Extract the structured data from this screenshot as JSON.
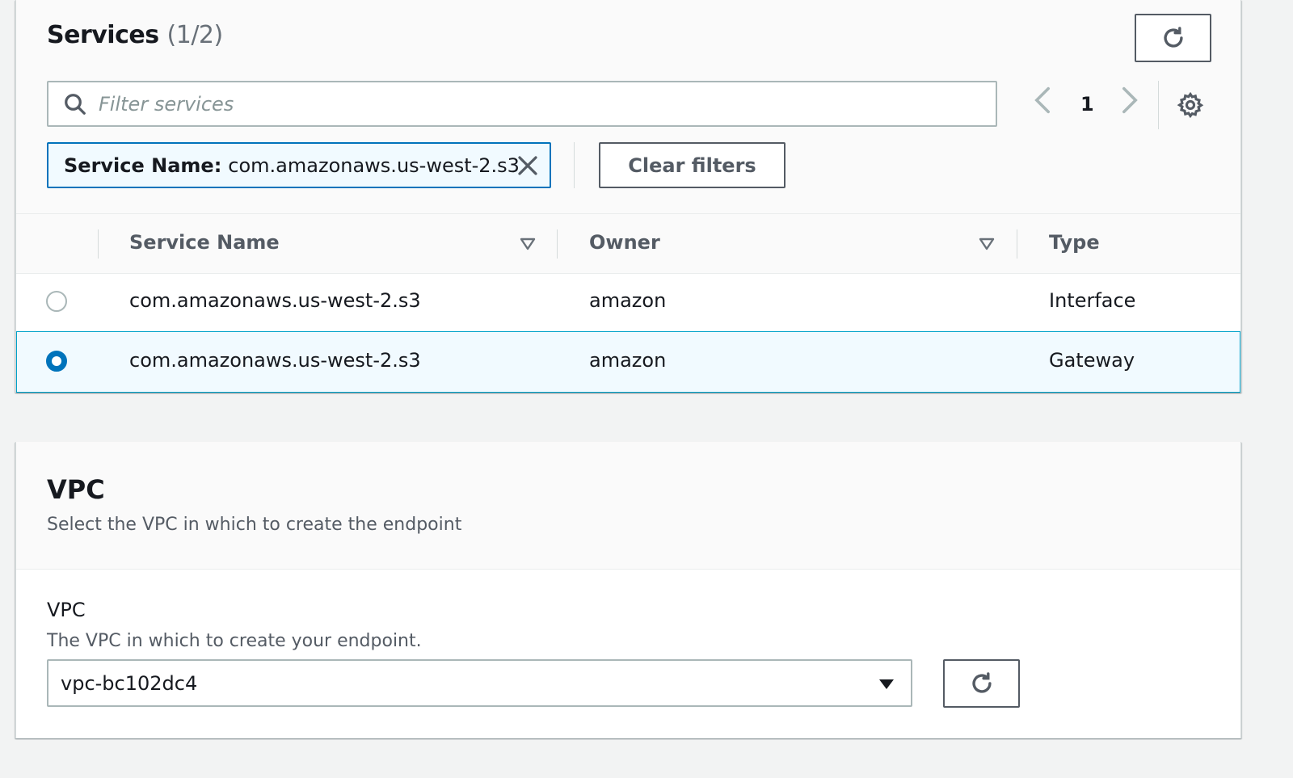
{
  "services": {
    "title": "Services",
    "count": "(1/2)",
    "filter_placeholder": "Filter services",
    "page": "1",
    "token": {
      "key": "Service Name:",
      "value": "com.amazonaws.us-west-2.s3"
    },
    "clear_filters_label": "Clear filters",
    "columns": {
      "service_name": "Service Name",
      "owner": "Owner",
      "type": "Type"
    },
    "rows": [
      {
        "service_name": "com.amazonaws.us-west-2.s3",
        "owner": "amazon",
        "type": "Interface",
        "selected": false
      },
      {
        "service_name": "com.amazonaws.us-west-2.s3",
        "owner": "amazon",
        "type": "Gateway",
        "selected": true
      }
    ]
  },
  "vpc": {
    "title": "VPC",
    "description": "Select the VPC in which to create the endpoint",
    "field_label": "VPC",
    "field_description": "The VPC in which to create your endpoint.",
    "selected_value": "vpc-bc102dc4"
  },
  "colors": {
    "accent": "#0073bb",
    "selected_row_bg": "#f1faff",
    "border": "#aab7b8"
  },
  "icons": [
    "refresh-icon",
    "search-icon",
    "chevron-left-icon",
    "chevron-right-icon",
    "gear-icon",
    "close-icon",
    "sort-caret-icon",
    "caret-down-icon"
  ]
}
